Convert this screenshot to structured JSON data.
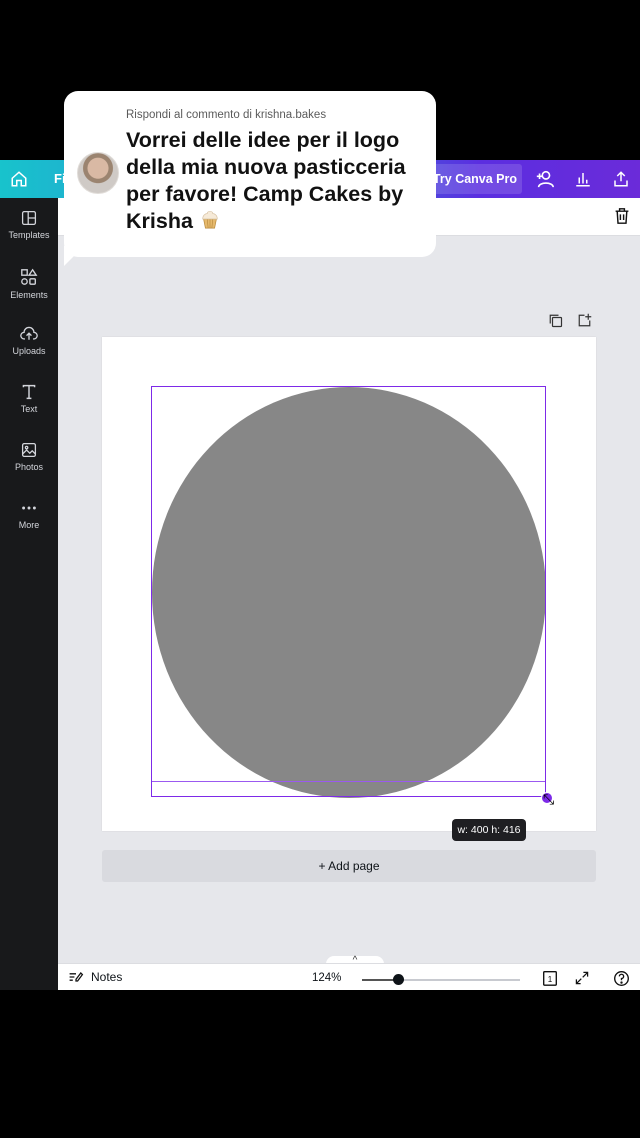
{
  "topbar": {
    "file_label": "Fi",
    "try_pro_label": "Try Canva Pro",
    "icons": [
      "home-icon",
      "add-people-icon",
      "insights-icon",
      "share-upload-icon"
    ]
  },
  "sidebar": {
    "items": [
      {
        "label": "Templates",
        "icon": "templates-icon"
      },
      {
        "label": "Elements",
        "icon": "elements-icon"
      },
      {
        "label": "Uploads",
        "icon": "uploads-icon"
      },
      {
        "label": "Text",
        "icon": "text-icon"
      },
      {
        "label": "Photos",
        "icon": "photos-icon"
      },
      {
        "label": "More",
        "icon": "more-icon"
      }
    ]
  },
  "canvas": {
    "element_dims": "w: 400 h: 416",
    "add_page_label": "+ Add page",
    "colors": {
      "shape_fill": "#878787",
      "selection": "#7d2ae8"
    }
  },
  "bottom_bar": {
    "notes_label": "Notes",
    "zoom_level": "124%",
    "zoom_slider_fraction": 0.24,
    "page_count": "1",
    "collapse_label": "^"
  },
  "comment": {
    "reply_to": "Rispondi al commento di krishna.bakes",
    "text": "Vorrei delle idee per il logo della mia nuova pasticceria per favore! Camp Cakes by Krisha"
  }
}
